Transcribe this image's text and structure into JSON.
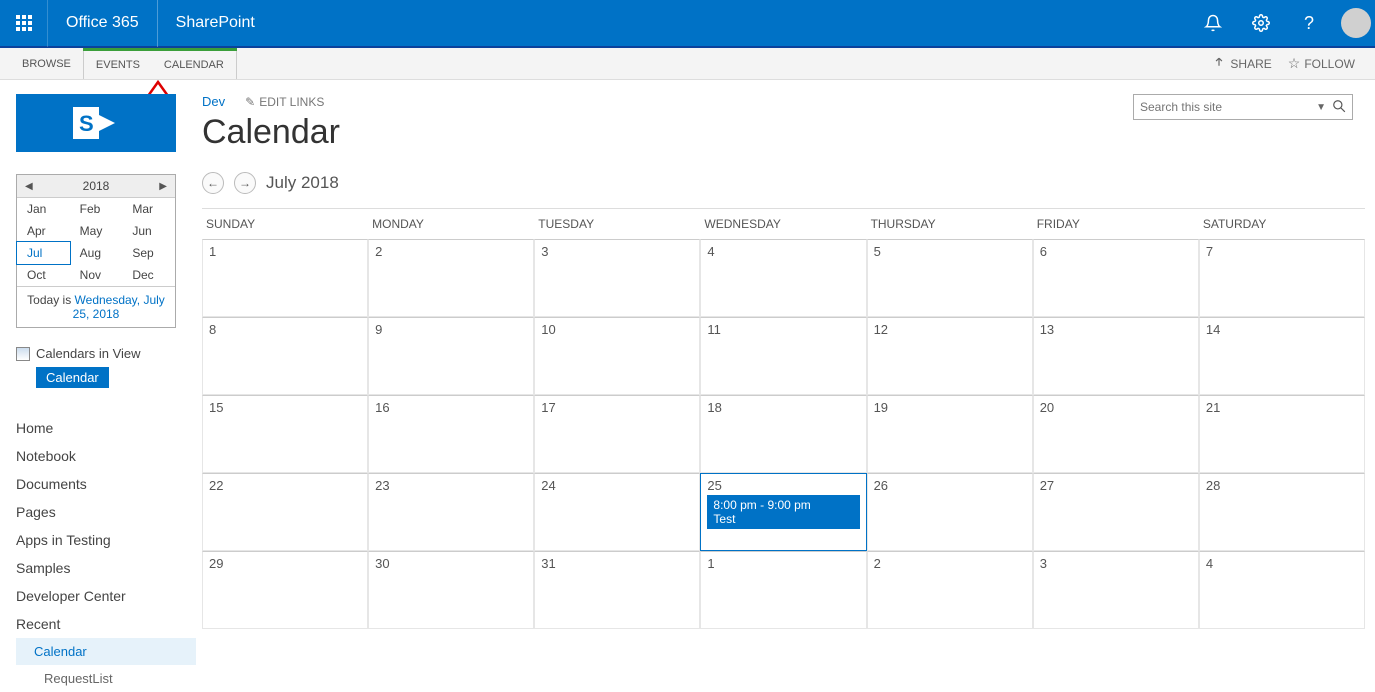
{
  "topbar": {
    "brand": "Office 365",
    "app": "SharePoint"
  },
  "ribbon": {
    "tabs": [
      "BROWSE",
      "EVENTS",
      "CALENDAR"
    ],
    "share": "SHARE",
    "follow": "FOLLOW"
  },
  "site": {
    "breadcrumb": "Dev",
    "edit_links": "EDIT LINKS",
    "title": "Calendar",
    "search_placeholder": "Search this site"
  },
  "mini_cal": {
    "year": "2018",
    "months": [
      "Jan",
      "Feb",
      "Mar",
      "Apr",
      "May",
      "Jun",
      "Jul",
      "Aug",
      "Sep",
      "Oct",
      "Nov",
      "Dec"
    ],
    "selected_month_index": 6,
    "today_prefix": "Today is ",
    "today_link": "Wednesday, July 25, 2018"
  },
  "calendars_in_view": {
    "label": "Calendars in View",
    "chip": "Calendar"
  },
  "quick_launch": {
    "items": [
      "Home",
      "Notebook",
      "Documents",
      "Pages",
      "Apps in Testing",
      "Samples",
      "Developer Center",
      "Recent"
    ],
    "recent_children": [
      "Calendar",
      "RequestList"
    ],
    "active_child_index": 0
  },
  "calendar": {
    "month_label": "July 2018",
    "day_headers": [
      "SUNDAY",
      "MONDAY",
      "TUESDAY",
      "WEDNESDAY",
      "THURSDAY",
      "FRIDAY",
      "SATURDAY"
    ],
    "weeks": [
      [
        {
          "n": "1"
        },
        {
          "n": "2"
        },
        {
          "n": "3"
        },
        {
          "n": "4"
        },
        {
          "n": "5"
        },
        {
          "n": "6"
        },
        {
          "n": "7"
        }
      ],
      [
        {
          "n": "8"
        },
        {
          "n": "9"
        },
        {
          "n": "10"
        },
        {
          "n": "11"
        },
        {
          "n": "12"
        },
        {
          "n": "13"
        },
        {
          "n": "14"
        }
      ],
      [
        {
          "n": "15"
        },
        {
          "n": "16"
        },
        {
          "n": "17"
        },
        {
          "n": "18"
        },
        {
          "n": "19"
        },
        {
          "n": "20"
        },
        {
          "n": "21"
        }
      ],
      [
        {
          "n": "22"
        },
        {
          "n": "23"
        },
        {
          "n": "24"
        },
        {
          "n": "25",
          "today": true,
          "event": {
            "time": "8:00 pm - 9:00 pm",
            "title": "Test"
          }
        },
        {
          "n": "26"
        },
        {
          "n": "27"
        },
        {
          "n": "28"
        }
      ],
      [
        {
          "n": "29"
        },
        {
          "n": "30"
        },
        {
          "n": "31"
        },
        {
          "n": "1"
        },
        {
          "n": "2"
        },
        {
          "n": "3"
        },
        {
          "n": "4"
        }
      ]
    ]
  }
}
